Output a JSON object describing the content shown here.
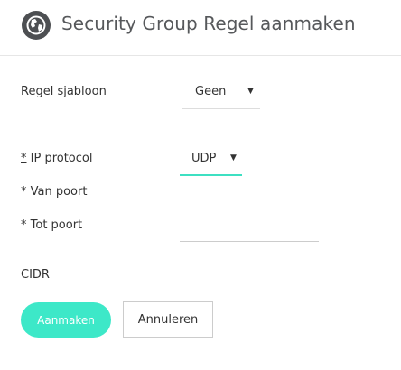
{
  "header": {
    "title": "Security Group Regel aanmaken",
    "icon": "globe-icon"
  },
  "form": {
    "rule_template": {
      "label": "Regel sjabloon",
      "value": "Geen"
    },
    "ip_protocol": {
      "required_marker": "*",
      "label": " IP protocol",
      "value": "UDP"
    },
    "port_from": {
      "label": "* Van poort",
      "value": ""
    },
    "port_to": {
      "label": "* Tot poort",
      "value": ""
    },
    "cidr": {
      "label": "CIDR",
      "value": ""
    }
  },
  "buttons": {
    "create": "Aanmaken",
    "cancel": "Annuleren"
  },
  "colors": {
    "accent": "#3de8c8",
    "icon": "#4d4f52"
  },
  "caret_glyph": "▼"
}
